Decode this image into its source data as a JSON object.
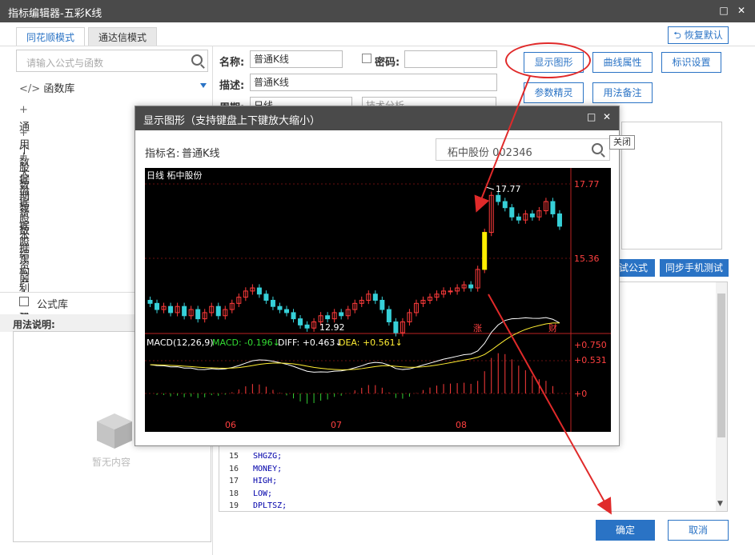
{
  "window": {
    "title": "指标编辑器-五彩K线",
    "restore_icon": "restore-icon",
    "close_icon": "close-icon"
  },
  "tabs": [
    {
      "label": "同花顺模式",
      "active": true
    },
    {
      "label": "通达信模式",
      "active": false
    }
  ],
  "restore_default": "恢复默认",
  "search": {
    "placeholder": "请输入公式与函数"
  },
  "func_lib": "函数库",
  "tree": [
    "通用数据",
    "个股数据",
    "大盘数据",
    "期货数据",
    "股本结构",
    "股东前十名",
    "资产负债表",
    "利润表",
    "现金流量"
  ],
  "formula_lib": "公式库",
  "usage_label": "用法说明:",
  "empty_text": "暂无内容",
  "form": {
    "name_label": "名称:",
    "name_value": "普通K线",
    "password_label": "密码:",
    "desc_label": "描述:",
    "desc_value": "普通K线",
    "period_label": "周期:",
    "period_value": "日线",
    "category_value": "技术分析"
  },
  "buttons": {
    "show_graph": "显示图形",
    "curve_attr": "曲线属性",
    "mark_setting": "标识设置",
    "param_wizard": "参数精灵",
    "usage_note": "用法备注",
    "test_formula": "测试公式",
    "sync_mobile": "同步手机测试",
    "ok": "确定",
    "cancel": "取消"
  },
  "code_lines": [
    {
      "num": "15",
      "text": "SHGZG;"
    },
    {
      "num": "16",
      "text": "MONEY;"
    },
    {
      "num": "17",
      "text": "HIGH;"
    },
    {
      "num": "18",
      "text": "LOW;"
    },
    {
      "num": "19",
      "text": "DPLTSZ;"
    }
  ],
  "dialog": {
    "title": "显示图形（支持键盘上下键放大缩小）",
    "indicator_label": "指标名:",
    "indicator_value": "普通K线",
    "stock": "柘中股份 002346",
    "close_tooltip": "关闭"
  },
  "chart_data": {
    "type": "candlestick",
    "title": "日线  柘中股份",
    "price_labels": [
      "17.77",
      "15.36"
    ],
    "annotations": [
      {
        "text": "17.77",
        "kind": "high"
      },
      {
        "text": "12.92",
        "kind": "low"
      },
      {
        "text": "涨"
      },
      {
        "text": "财"
      }
    ],
    "months": [
      "06",
      "07",
      "08"
    ],
    "macd": {
      "title": "MACD(12,26,9)",
      "macd_label": "MACD: -0.196↓",
      "diff_label": "DIFF: +0.463↓",
      "dea_label": "DEA: +0.561↓",
      "ticks": [
        "+0.750",
        "+0.531",
        "+0"
      ]
    },
    "closes": [
      13.9,
      13.7,
      13.8,
      13.6,
      13.8,
      13.5,
      13.7,
      13.4,
      13.6,
      13.8,
      13.5,
      13.7,
      13.9,
      14.1,
      14.3,
      14.4,
      14.2,
      14.0,
      13.8,
      13.7,
      13.6,
      13.4,
      13.2,
      13.1,
      13.3,
      13.5,
      13.4,
      13.6,
      13.5,
      13.7,
      13.9,
      14.0,
      14.2,
      14.0,
      13.7,
      13.3,
      12.95,
      13.3,
      13.6,
      13.9,
      14.0,
      14.1,
      14.2,
      14.3,
      14.3,
      14.4,
      14.5,
      14.4,
      15.0,
      16.2,
      17.4,
      17.2,
      17.0,
      16.7,
      16.6,
      16.8,
      16.7,
      16.9,
      17.2,
      16.8,
      16.4
    ]
  },
  "colors": {
    "accent": "#2a73c5",
    "up": "#ff3b3b",
    "down": "#36d0d8",
    "titlebar": "#4a4a4a"
  }
}
